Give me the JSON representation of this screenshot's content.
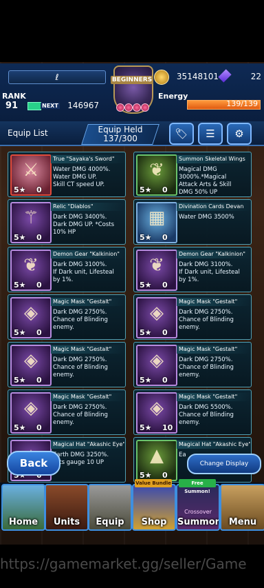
{
  "header": {
    "player_name": "ℓ",
    "emblem_label": "BEGINNERS",
    "gold": "35148101",
    "crystals": "22",
    "rank_label": "RANK",
    "rank": "91",
    "next_label": "NEXT",
    "xp_to_next": "146967",
    "energy_label": "Energy",
    "energy": "139/139",
    "energy_fraction": 1.0
  },
  "toolbar": {
    "title": "Equip List",
    "held_label": "Equip Held",
    "held_value": "137/300",
    "buttons": [
      {
        "icon": "tag-icon",
        "glyph": "🏷"
      },
      {
        "icon": "sort-icon",
        "glyph": "☰"
      },
      {
        "icon": "gear-icon",
        "glyph": "⚙"
      }
    ]
  },
  "equipment": [
    {
      "name": "True \"Sayaka's Sword\"",
      "desc": "Water DMG 4000%.\nWater DMG UP.\nSkill CT speed UP.",
      "stars": "5",
      "limit": "0",
      "icon": "sword-icon",
      "frame": "red"
    },
    {
      "name": "Summon Skeletal Wings",
      "desc": "Magical DMG\n3000%.*Magical\nAttack Arts & Skill\nDMG 50% UP",
      "stars": "5",
      "limit": "0",
      "icon": "wings-icon",
      "frame": "green"
    },
    {
      "name": "Relic \"Diablos\"",
      "desc": "Dark DMG 3400%.\nDark DMG UP. *Costs\n10% HP",
      "stars": "5",
      "limit": "0",
      "icon": "staff-icon",
      "frame": "purple"
    },
    {
      "name": "Divination Cards Devan",
      "desc": "Water DMG 3500%",
      "stars": "5",
      "limit": "0",
      "icon": "cards-icon",
      "frame": "blue"
    },
    {
      "name": "Demon Gear \"Kalkinion\"",
      "desc": "Dark DMG 3100%.\nIf Dark unit, Lifesteal\nby 1%.",
      "stars": "5",
      "limit": "0",
      "icon": "wings-icon",
      "frame": "purple"
    },
    {
      "name": "Demon Gear \"Kalkinion\"",
      "desc": "Dark DMG 3100%.\nIf Dark unit, Lifesteal\nby 1%.",
      "stars": "5",
      "limit": "0",
      "icon": "wings-icon",
      "frame": "purple"
    },
    {
      "name": "Magic Mask \"Gestalt\"",
      "desc": "Dark DMG 2750%.\nChance of Blinding\nenemy.",
      "stars": "5",
      "limit": "0",
      "icon": "mask-icon",
      "frame": "purple"
    },
    {
      "name": "Magic Mask \"Gestalt\"",
      "desc": "Dark DMG 2750%.\nChance of Blinding\nenemy.",
      "stars": "5",
      "limit": "0",
      "icon": "mask-icon",
      "frame": "purple"
    },
    {
      "name": "Magic Mask \"Gestalt\"",
      "desc": "Dark DMG 2750%.\nChance of Blinding\nenemy.",
      "stars": "5",
      "limit": "0",
      "icon": "mask-icon",
      "frame": "purple"
    },
    {
      "name": "Magic Mask \"Gestalt\"",
      "desc": "Dark DMG 2750%.\nChance of Blinding\nenemy.",
      "stars": "5",
      "limit": "0",
      "icon": "mask-icon",
      "frame": "purple"
    },
    {
      "name": "Magic Mask \"Gestalt\"",
      "desc": "Dark DMG 2750%.\nChance of Blinding\nenemy.",
      "stars": "5",
      "limit": "0",
      "icon": "mask-icon",
      "frame": "purple"
    },
    {
      "name": "Magic Mask \"Gestalt\"",
      "desc": "Dark DMG 5500%.\nChance of Blinding\nenemy.",
      "stars": "5",
      "limit": "10",
      "icon": "mask-icon",
      "frame": "purple"
    },
    {
      "name": "Magical Hat \"Akashic Eye\"",
      "desc": "Earth DMG 3250%.\nArts gauge 10 UP",
      "stars": "5",
      "limit": "0",
      "icon": "hat-icon",
      "frame": "purple"
    },
    {
      "name": "Magical Hat \"Akashic Eye\"",
      "desc": "Ea",
      "stars": "5",
      "limit": "0",
      "icon": "hat-icon",
      "frame": "green"
    }
  ],
  "controls": {
    "back": "Back",
    "change_display": "Change Display"
  },
  "nav": [
    {
      "label": "Home",
      "icon": "home-icon"
    },
    {
      "label": "Units",
      "icon": "units-icon"
    },
    {
      "label": "Equip",
      "icon": "equip-icon"
    },
    {
      "label": "Shop",
      "icon": "shop-icon",
      "badge": "Value Bundle"
    },
    {
      "label": "Summon",
      "icon": "summon-icon",
      "badge": "Free Summon!",
      "sublabel": "Crossover"
    },
    {
      "label": "Menu",
      "icon": "menu-icon"
    }
  ],
  "watermark": "https://gamemarket.gg/seller/Game"
}
